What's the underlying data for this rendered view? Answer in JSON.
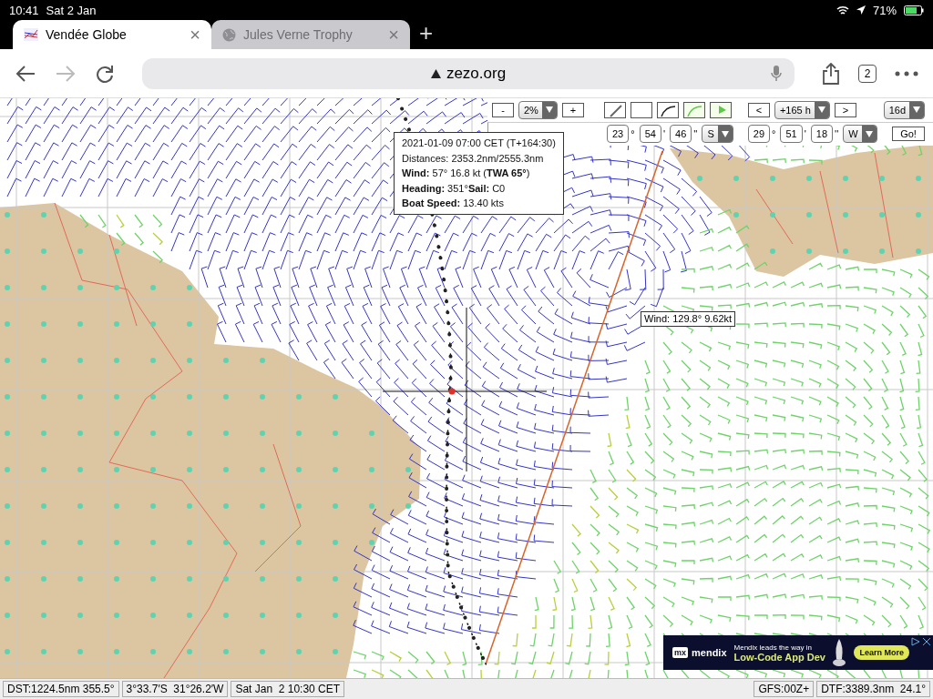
{
  "status_bar": {
    "time": "10:41",
    "date": "Sat 2 Jan",
    "battery": "71%"
  },
  "tabs": [
    {
      "title": "Vendée Globe",
      "selected": true,
      "close": "×"
    },
    {
      "title": "Jules Verne Trophy",
      "selected": false,
      "close": "×"
    }
  ],
  "new_tab": "+",
  "address_bar": {
    "url": "zezo.org"
  },
  "tab_count": "2",
  "map_controls": {
    "zoom_out": "-",
    "zoom_level": "2%",
    "zoom_in": "+",
    "tools": [
      {
        "kind": "ruler",
        "on": false
      },
      {
        "kind": "blank",
        "on": false
      },
      {
        "kind": "polar",
        "on": false
      },
      {
        "kind": "polar",
        "on": true
      },
      {
        "kind": "flag",
        "on": true
      }
    ],
    "time_prev": "<",
    "time_offset": "+165 h",
    "time_next": ">",
    "range": "16d",
    "lat": {
      "deg": "23",
      "min": "54",
      "sec": "46",
      "hemi": "S"
    },
    "lon": {
      "deg": "29",
      "min": "51",
      "sec": "18",
      "hemi": "W"
    },
    "units": [
      "°",
      "'",
      "''"
    ],
    "go": "Go!"
  },
  "tooltip": {
    "lines": [
      "2021-01-09 07:00 CET (T+164:30)",
      "Distances: 2353.2nm/2555.3nm",
      "**Wind:** 57° 16.8 kt (**TWA 65°**)",
      "**Heading:** 351°**Sail:** C0",
      "**Boat Speed:** 13.40 kts"
    ]
  },
  "wind_label": "Wind: 129.8° 9.62kt",
  "ad": {
    "logo": "mx",
    "brand": "mendix",
    "headline": "Mendix leads the way in",
    "subhead": "Low-Code App Dev",
    "button": "Learn More"
  },
  "footer": {
    "left": [
      "DST:1224.5nm 355.5°",
      "3°33.7′S  31°26.2′W",
      "Sat Jan  2 10:30 CET"
    ],
    "right": [
      "GFS:00Z+",
      "DTF:3389.3nm  24.1°"
    ]
  }
}
